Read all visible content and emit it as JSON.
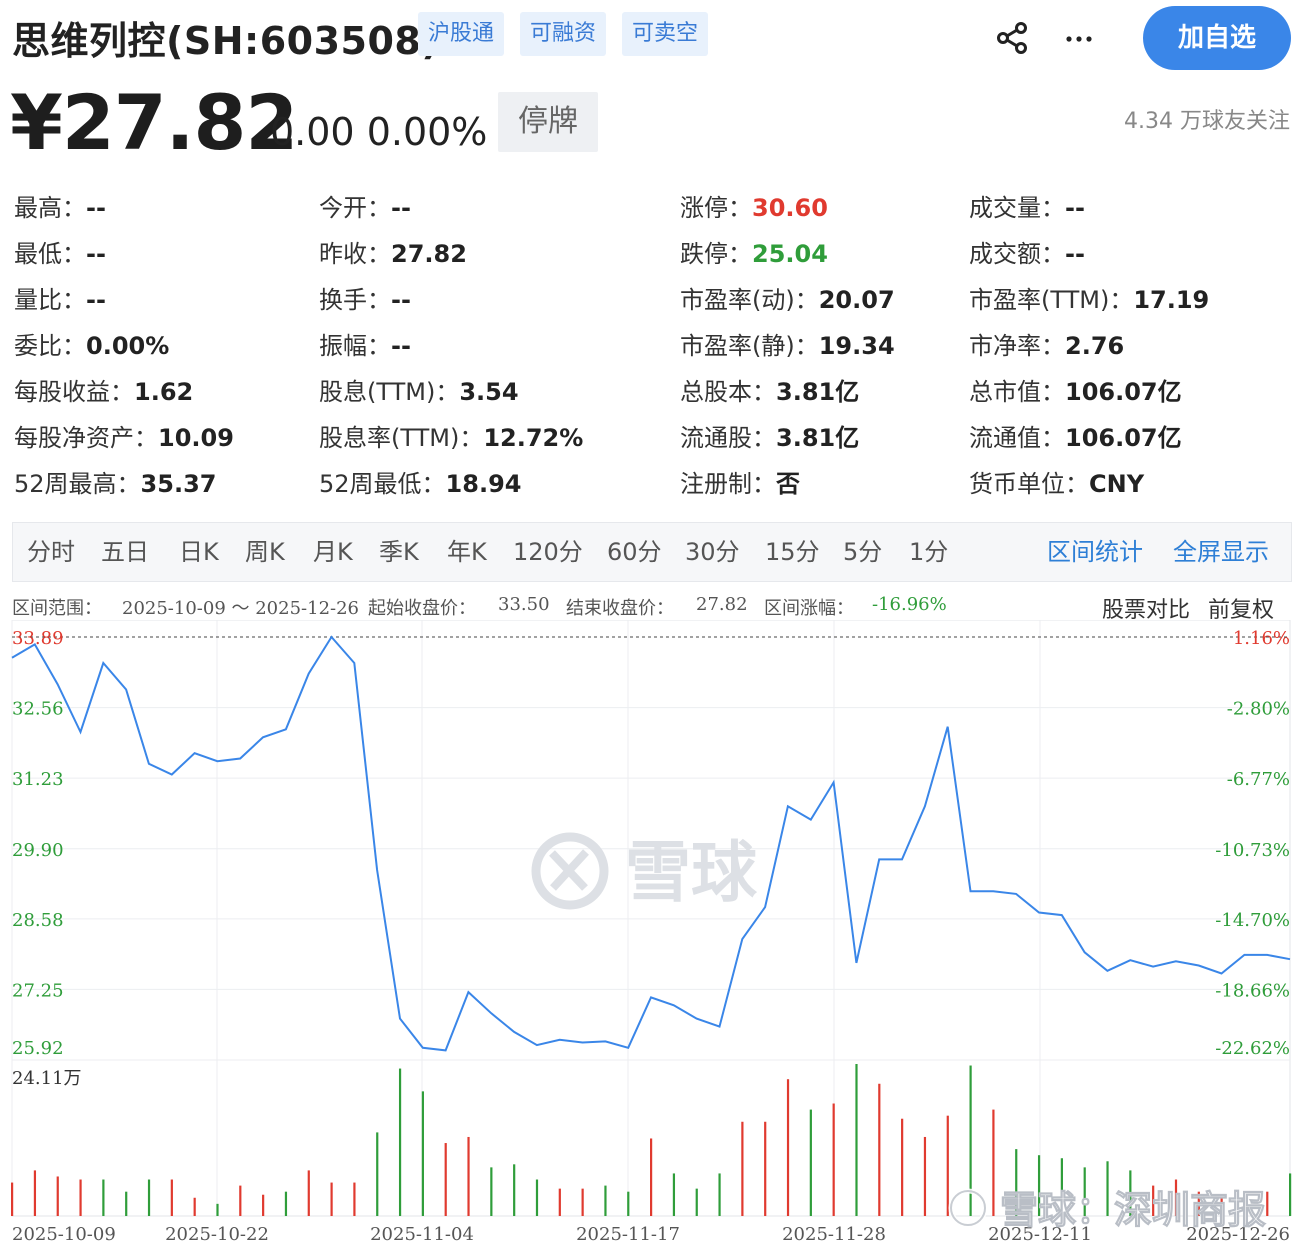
{
  "header": {
    "title": "思维列控(SH:603508)",
    "tags": [
      "沪股通",
      "可融资",
      "可卖空"
    ],
    "add_button": "加自选",
    "share_icon": "share-icon",
    "more_icon": "more-icon"
  },
  "quote": {
    "price": "¥27.82",
    "change": "0.00 0.00%",
    "status": "停牌",
    "followers": "4.34 万球友关注"
  },
  "colors": {
    "up": "#e03a2f",
    "down": "#2f9d3a",
    "accent": "#3a86e8",
    "line": "#3a86e8"
  },
  "stats": [
    [
      {
        "k": "最高：",
        "v": "--"
      },
      {
        "k": "今开：",
        "v": "--"
      },
      {
        "k": "涨停：",
        "v": "30.60",
        "c": "up"
      },
      {
        "k": "成交量：",
        "v": "--"
      }
    ],
    [
      {
        "k": "最低：",
        "v": "--"
      },
      {
        "k": "昨收：",
        "v": "27.82"
      },
      {
        "k": "跌停：",
        "v": "25.04",
        "c": "down"
      },
      {
        "k": "成交额：",
        "v": "--"
      }
    ],
    [
      {
        "k": "量比：",
        "v": "--"
      },
      {
        "k": "换手：",
        "v": "--"
      },
      {
        "k": "市盈率(动)：",
        "v": "20.07"
      },
      {
        "k": "市盈率(TTM)：",
        "v": "17.19"
      }
    ],
    [
      {
        "k": "委比：",
        "v": "0.00%"
      },
      {
        "k": "振幅：",
        "v": "--"
      },
      {
        "k": "市盈率(静)：",
        "v": "19.34"
      },
      {
        "k": "市净率：",
        "v": "2.76"
      }
    ],
    [
      {
        "k": "每股收益：",
        "v": "1.62"
      },
      {
        "k": "股息(TTM)：",
        "v": "3.54"
      },
      {
        "k": "总股本：",
        "v": "3.81亿"
      },
      {
        "k": "总市值：",
        "v": "106.07亿"
      }
    ],
    [
      {
        "k": "每股净资产：",
        "v": "10.09"
      },
      {
        "k": "股息率(TTM)：",
        "v": "12.72%"
      },
      {
        "k": "流通股：",
        "v": "3.81亿"
      },
      {
        "k": "流通值：",
        "v": "106.07亿"
      }
    ],
    [
      {
        "k": "52周最高：",
        "v": "35.37"
      },
      {
        "k": "52周最低：",
        "v": "18.94"
      },
      {
        "k": "注册制：",
        "v": "否"
      },
      {
        "k": "货币单位：",
        "v": "CNY"
      }
    ]
  ],
  "tabs": [
    "分时",
    "五日",
    "日K",
    "周K",
    "月K",
    "季K",
    "年K",
    "120分",
    "60分",
    "30分",
    "15分",
    "5分",
    "1分"
  ],
  "tab_actions": [
    "区间统计",
    "全屏显示"
  ],
  "range_info": {
    "range_label": "区间范围：",
    "range_value": "2025-10-09 ～ 2025-12-26",
    "start_label": "起始收盘价：",
    "start_value": "33.50",
    "end_label": "结束收盘价：",
    "end_value": "27.82",
    "pct_label": "区间涨幅：",
    "pct_value": "-16.96%",
    "compare": "股票对比",
    "adjust": "前复权"
  },
  "watermark": {
    "center": "雪球",
    "corner": "雪球：深圳商报"
  },
  "chart_data": {
    "type": "line",
    "y_ticks_left": [
      "33.89",
      "32.56",
      "31.23",
      "29.90",
      "28.58",
      "27.25",
      "25.92"
    ],
    "y_ticks_right": [
      "1.16%",
      "-2.80%",
      "-6.77%",
      "-10.73%",
      "-14.70%",
      "-18.66%",
      "-22.62%"
    ],
    "ylim": [
      25.92,
      33.89
    ],
    "x_labels": [
      "2025-10-09",
      "2025-10-22",
      "2025-11-04",
      "2025-11-17",
      "2025-11-28",
      "2025-12-11",
      "2025-12-26"
    ],
    "volume_max_label": "24.11万",
    "close": [
      33.5,
      33.75,
      33.0,
      32.1,
      33.4,
      32.9,
      31.5,
      31.3,
      31.7,
      31.55,
      31.6,
      32.0,
      32.15,
      33.2,
      33.89,
      33.4,
      29.5,
      26.7,
      26.15,
      26.1,
      27.2,
      26.8,
      26.45,
      26.2,
      26.3,
      26.25,
      26.27,
      26.15,
      27.1,
      26.95,
      26.7,
      26.55,
      28.2,
      28.8,
      30.7,
      30.45,
      31.15,
      27.75,
      29.7,
      29.7,
      30.7,
      32.2,
      29.1,
      29.1,
      29.05,
      28.7,
      28.65,
      27.95,
      27.6,
      27.8,
      27.68,
      27.78,
      27.7,
      27.55,
      27.9,
      27.9,
      27.82
    ],
    "volume": [
      {
        "v": 0.22,
        "d": "up"
      },
      {
        "v": 0.3,
        "d": "up"
      },
      {
        "v": 0.26,
        "d": "up"
      },
      {
        "v": 0.24,
        "d": "up"
      },
      {
        "v": 0.24,
        "d": "down"
      },
      {
        "v": 0.16,
        "d": "down"
      },
      {
        "v": 0.24,
        "d": "down"
      },
      {
        "v": 0.24,
        "d": "up"
      },
      {
        "v": 0.12,
        "d": "up"
      },
      {
        "v": 0.08,
        "d": "down"
      },
      {
        "v": 0.2,
        "d": "up"
      },
      {
        "v": 0.14,
        "d": "up"
      },
      {
        "v": 0.16,
        "d": "down"
      },
      {
        "v": 0.3,
        "d": "up"
      },
      {
        "v": 0.22,
        "d": "up"
      },
      {
        "v": 0.22,
        "d": "up"
      },
      {
        "v": 0.55,
        "d": "down"
      },
      {
        "v": 0.97,
        "d": "down"
      },
      {
        "v": 0.82,
        "d": "down"
      },
      {
        "v": 0.48,
        "d": "up"
      },
      {
        "v": 0.52,
        "d": "up"
      },
      {
        "v": 0.32,
        "d": "down"
      },
      {
        "v": 0.34,
        "d": "down"
      },
      {
        "v": 0.24,
        "d": "down"
      },
      {
        "v": 0.18,
        "d": "up"
      },
      {
        "v": 0.18,
        "d": "up"
      },
      {
        "v": 0.2,
        "d": "down"
      },
      {
        "v": 0.16,
        "d": "down"
      },
      {
        "v": 0.51,
        "d": "up"
      },
      {
        "v": 0.28,
        "d": "down"
      },
      {
        "v": 0.18,
        "d": "down"
      },
      {
        "v": 0.28,
        "d": "down"
      },
      {
        "v": 0.62,
        "d": "up"
      },
      {
        "v": 0.62,
        "d": "up"
      },
      {
        "v": 0.9,
        "d": "up"
      },
      {
        "v": 0.7,
        "d": "down"
      },
      {
        "v": 0.74,
        "d": "up"
      },
      {
        "v": 1.0,
        "d": "down"
      },
      {
        "v": 0.87,
        "d": "up"
      },
      {
        "v": 0.64,
        "d": "up"
      },
      {
        "v": 0.52,
        "d": "up"
      },
      {
        "v": 0.66,
        "d": "up"
      },
      {
        "v": 0.99,
        "d": "down"
      },
      {
        "v": 0.7,
        "d": "up"
      },
      {
        "v": 0.44,
        "d": "down"
      },
      {
        "v": 0.4,
        "d": "down"
      },
      {
        "v": 0.38,
        "d": "down"
      },
      {
        "v": 0.32,
        "d": "down"
      },
      {
        "v": 0.36,
        "d": "down"
      },
      {
        "v": 0.3,
        "d": "down"
      },
      {
        "v": 0.2,
        "d": "up"
      },
      {
        "v": 0.24,
        "d": "up"
      },
      {
        "v": 0.16,
        "d": "up"
      },
      {
        "v": 0.14,
        "d": "up"
      },
      {
        "v": 0.12,
        "d": "up"
      },
      {
        "v": 0.16,
        "d": "up"
      },
      {
        "v": 0.28,
        "d": "down"
      }
    ]
  }
}
